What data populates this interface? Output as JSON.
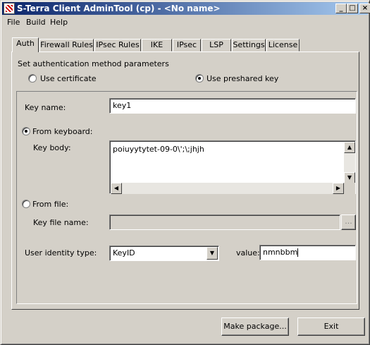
{
  "window": {
    "title": "S-Terra Client AdminTool (cp) - <No name>"
  },
  "titlebar_buttons": {
    "minimize": "_",
    "maximize": "□",
    "close": "×"
  },
  "menu": [
    "File",
    "Build",
    "Help"
  ],
  "tabs": [
    "Auth",
    "Firewall Rules",
    "IPsec Rules",
    "IKE",
    "IPsec",
    "LSP",
    "Settings",
    "License"
  ],
  "active_tab": "Auth",
  "auth": {
    "heading": "Set authentication method parameters",
    "method_options": [
      {
        "label": "Use certificate",
        "checked": false
      },
      {
        "label": "Use preshared key",
        "checked": true
      }
    ],
    "key_name_label": "Key name:",
    "key_name_value": "key1",
    "source_options": [
      {
        "label": "From keyboard:",
        "checked": true
      },
      {
        "label": "From file:",
        "checked": false
      }
    ],
    "key_body_label": "Key body:",
    "key_body_value": "poiuyytytet-09-0\\';\\;jhjh",
    "key_file_label": "Key file name:",
    "key_file_value": "",
    "browse_label": "...",
    "identity_type_label": "User identity type:",
    "identity_type_value": "KeyID",
    "value_label": "value:",
    "value_value": "nmnbbm"
  },
  "buttons": {
    "make_package": "Make package...",
    "exit": "Exit"
  }
}
